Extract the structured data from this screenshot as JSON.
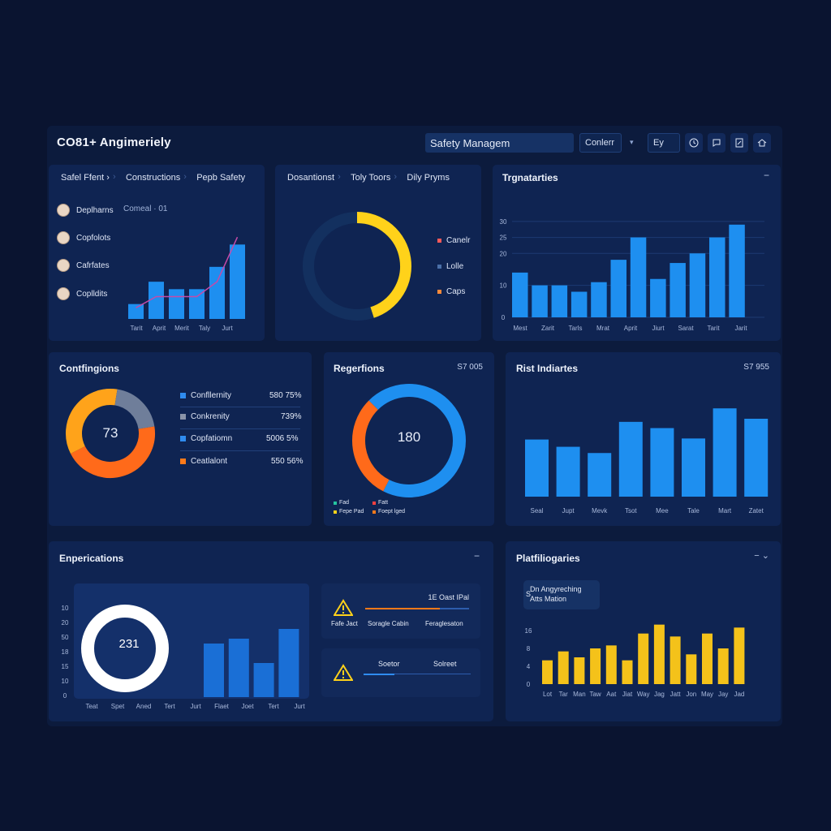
{
  "header": {
    "title": "CO81+  Angimeriely",
    "search_value": "Safety Managem",
    "select_value": "Conlerr",
    "filter_value": "Ey",
    "icons": [
      "clock-icon",
      "chat-icon",
      "document-icon",
      "home-icon"
    ]
  },
  "card1": {
    "tabs": [
      "Safel Ffent",
      "Constructions",
      "Pepb Safety"
    ],
    "people": [
      "Deplharns",
      "Copfolots",
      "Cafrfates",
      "Coplldits"
    ],
    "people_note": "Comeal · 01",
    "x_labels": [
      "Tarit",
      "Aprit",
      "Merit",
      "Taly",
      "Jurt"
    ]
  },
  "card2": {
    "tabs": [
      "Dosantionst",
      "Toly Toors",
      "Dily Pryms"
    ],
    "legend": [
      {
        "label": "Canelr",
        "color": "#ff5a5a"
      },
      {
        "label": "Lolle",
        "color": "#4a6fa8"
      },
      {
        "label": "Caps",
        "color": "#ff8a3a"
      }
    ]
  },
  "card3": {
    "title": "Trgnatarties",
    "y_ticks": [
      "0",
      "10",
      "20",
      "25",
      "30"
    ],
    "x_labels": [
      "Mest",
      "Zarit",
      "Tarls",
      "Mrat",
      "Aprit",
      "Jiurt",
      "Sarat",
      "Tarit",
      "Jarit"
    ]
  },
  "card4": {
    "title": "Contfingions",
    "center_value": "73",
    "rows": [
      {
        "label": "Confllernity",
        "value": "580 75%",
        "color": "#2f8cf0"
      },
      {
        "label": "Conkrenity",
        "value": "739%",
        "color": "#8a94a8"
      },
      {
        "label": "Copfatiomn",
        "value": "5006 5%",
        "color": "#2f8cf0"
      },
      {
        "label": "Ceatlalont",
        "value": "550 56%",
        "color": "#ff7a1a"
      }
    ]
  },
  "card5": {
    "title": "Regerfions",
    "value": "S7 005",
    "center_value": "180",
    "legend": [
      {
        "label": "Fad",
        "color": "#25c5a0"
      },
      {
        "label": "Fatt",
        "color": "#ff4040"
      },
      {
        "label": "Fepe Pad",
        "color": "#ffd21a"
      },
      {
        "label": "Foept lged",
        "color": "#ff7a1a"
      }
    ]
  },
  "card6": {
    "title": "Rist Indiartes",
    "value": "S7 955",
    "x_labels": [
      "Seal",
      "Jupt",
      "Mevk",
      "Tsot",
      "Mee",
      "Tale",
      "Mart",
      "Zatet"
    ]
  },
  "card7": {
    "title": "Enperications",
    "collapse": "−",
    "y_ticks": [
      "0",
      "10",
      "15",
      "18",
      "50",
      "20",
      "10"
    ],
    "center_value": "231",
    "x_labels": [
      "Teat",
      "Spet",
      "Aned",
      "Tert",
      "Jurt",
      "Flaet",
      "Joet",
      "Tert",
      "Jurt"
    ],
    "alert1": {
      "right": "1E Oast IPal",
      "labels": [
        "Fafe Jact",
        "Soragle Cabin",
        "Feraglesaton"
      ]
    },
    "alert2": {
      "labels": [
        "Soetor",
        "Solreet"
      ]
    }
  },
  "card8": {
    "title": "Platfiliogaries",
    "collapse": "− ⌄",
    "tooltip_line1": "Dn Angyreching",
    "tooltip_line2": "Atts Mation",
    "tooltip_s": "S",
    "y_ticks": [
      "0",
      "4",
      "8",
      "16"
    ],
    "x_labels": [
      "Lot",
      "Tar",
      "Man",
      "Taw",
      "Aat",
      "Jiat",
      "Way",
      "Jag",
      "Jatt",
      "Jon",
      "May",
      "Jay",
      "Jad"
    ]
  },
  "chart_data": [
    {
      "type": "bar",
      "categories": [
        "Tarit",
        "Aprit",
        "Merit",
        "Taly",
        "Jurt"
      ],
      "values": [
        2,
        5,
        4,
        4,
        7,
        10
      ],
      "line_values": [
        1.5,
        3,
        3,
        3,
        5,
        11
      ]
    },
    {
      "type": "pie",
      "values": [
        45,
        55
      ],
      "colors": [
        "#ffd21a",
        "#13305f"
      ]
    },
    {
      "type": "bar",
      "categories": [
        "Mest",
        "Zarit",
        "Tarls",
        "Mrat",
        "Aprit",
        "Jiurt",
        "Sarat",
        "Tarit",
        "Jarit"
      ],
      "values": [
        14,
        10,
        10,
        8,
        11,
        18,
        25,
        12,
        17,
        20,
        25,
        29
      ],
      "ylim": [
        0,
        32
      ]
    },
    {
      "type": "pie",
      "values": [
        45,
        35,
        20
      ],
      "colors": [
        "#ff6a1a",
        "#ffa31a",
        "#6f7e9a"
      ]
    },
    {
      "type": "pie",
      "values": [
        70,
        30
      ],
      "colors": [
        "#1e8ff0",
        "#ff6a1a"
      ]
    },
    {
      "type": "bar",
      "categories": [
        "Seal",
        "Jupt",
        "Mevk",
        "Tsot",
        "Mee",
        "Tale",
        "Mart",
        "Zatet"
      ],
      "values": [
        55,
        48,
        42,
        72,
        66,
        56,
        85,
        75
      ],
      "ylim": [
        0,
        100
      ]
    },
    {
      "type": "bar",
      "categories": [
        "Flaet",
        "Joet",
        "Tert",
        "Jurt"
      ],
      "values": [
        55,
        60,
        35,
        70
      ],
      "ylim": [
        0,
        100
      ]
    },
    {
      "type": "bar",
      "categories": [
        "Lot",
        "Tar",
        "Man",
        "Taw",
        "Aat",
        "Jiat",
        "Way",
        "Jag",
        "Jatt",
        "Jon",
        "May",
        "Jay",
        "Jad"
      ],
      "values": [
        8,
        11,
        9,
        12,
        13,
        8,
        17,
        20,
        16,
        10,
        17,
        12,
        19
      ],
      "ylim": [
        0,
        24
      ]
    }
  ]
}
